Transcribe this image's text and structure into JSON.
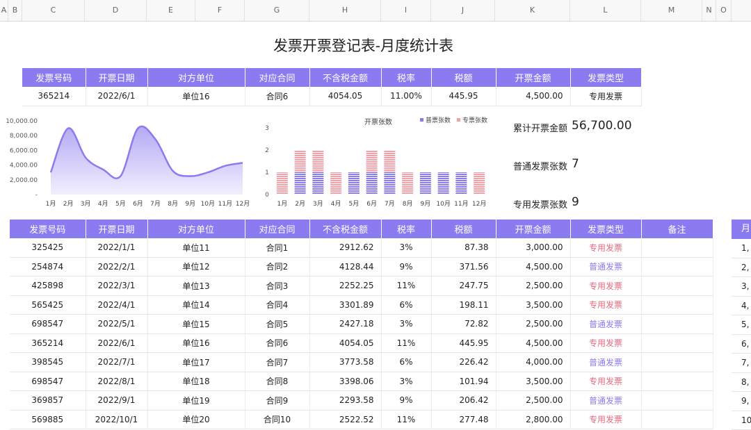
{
  "columns": [
    "A",
    "B",
    "C",
    "D",
    "E",
    "F",
    "G",
    "H",
    "I",
    "J",
    "K",
    "L",
    "M",
    "N",
    "O"
  ],
  "title": "发票开票登记表-月度统计表",
  "lookup": {
    "headers": [
      "发票号码",
      "开票日期",
      "对方单位",
      "对应合同",
      "不含税金额",
      "税率",
      "税额",
      "开票金额",
      "发票类型"
    ],
    "row": [
      "365214",
      "2022/6/1",
      "单位16",
      "合同6",
      "4054.05",
      "11.00%",
      "445.95",
      "4,500.00",
      "专用发票"
    ]
  },
  "stats": {
    "total_label": "累计开票金额",
    "total_value": "56,700.00",
    "normal_label": "普通发票张数",
    "normal_value": "7",
    "special_label": "专用发票张数",
    "special_value": "9"
  },
  "chart_data": [
    {
      "type": "area",
      "x": [
        "1月",
        "2月",
        "3月",
        "4月",
        "5月",
        "6月",
        "7月",
        "8月",
        "9月",
        "10月",
        "11月",
        "12月"
      ],
      "values": [
        3000,
        9000,
        5000,
        3400,
        2500,
        9000,
        7500,
        3200,
        2500,
        3000,
        3900,
        4300
      ],
      "ylim": [
        0,
        10000
      ],
      "yticks": [
        "10,000.00",
        "8,000.00",
        "6,000.00",
        "4,000.00",
        "2,000.00",
        "-"
      ],
      "color": "#8b7bf0"
    },
    {
      "type": "bar",
      "title": "开票张数",
      "categories": [
        "1月",
        "2月",
        "3月",
        "4月",
        "5月",
        "6月",
        "7月",
        "8月",
        "9月",
        "10月",
        "11月",
        "12月"
      ],
      "series": [
        {
          "name": "普票张数",
          "values": [
            0,
            1,
            1,
            0,
            1,
            1,
            1,
            0,
            1,
            1,
            1,
            0
          ],
          "color": "#8b7bf0"
        },
        {
          "name": "专票张数",
          "values": [
            1,
            1,
            1,
            1,
            0,
            1,
            1,
            1,
            0,
            0,
            0,
            1
          ],
          "color": "#f4a0a8"
        }
      ],
      "ylim": [
        0,
        3
      ],
      "yticks": [
        "3",
        "2",
        "1",
        "0"
      ],
      "legend": "top-right"
    }
  ],
  "main": {
    "headers": [
      "发票号码",
      "开票日期",
      "对方单位",
      "对应合同",
      "不含税金额",
      "税率",
      "税额",
      "开票金额",
      "发票类型",
      "备注"
    ],
    "rows": [
      [
        "325425",
        "2022/1/1",
        "单位11",
        "合同1",
        "2912.62",
        "3%",
        "87.38",
        "3,000.00",
        "专用发票",
        ""
      ],
      [
        "254874",
        "2022/2/1",
        "单位12",
        "合同2",
        "4128.44",
        "9%",
        "371.56",
        "4,500.00",
        "普通发票",
        ""
      ],
      [
        "425898",
        "2022/3/1",
        "单位13",
        "合同3",
        "2252.25",
        "11%",
        "247.75",
        "2,500.00",
        "专用发票",
        ""
      ],
      [
        "565425",
        "2022/4/1",
        "单位14",
        "合同4",
        "3301.89",
        "6%",
        "198.11",
        "3,500.00",
        "专用发票",
        ""
      ],
      [
        "698547",
        "2022/5/1",
        "单位15",
        "合同5",
        "2427.18",
        "3%",
        "72.82",
        "2,500.00",
        "普通发票",
        ""
      ],
      [
        "365214",
        "2022/6/1",
        "单位16",
        "合同6",
        "4054.05",
        "11%",
        "445.95",
        "4,500.00",
        "专用发票",
        ""
      ],
      [
        "398545",
        "2022/7/1",
        "单位17",
        "合同7",
        "3773.58",
        "6%",
        "226.42",
        "4,000.00",
        "普通发票",
        ""
      ],
      [
        "698547",
        "2022/8/1",
        "单位18",
        "合同8",
        "3398.06",
        "3%",
        "101.94",
        "3,500.00",
        "专用发票",
        ""
      ],
      [
        "369857",
        "2022/9/1",
        "单位19",
        "合同9",
        "2293.58",
        "9%",
        "206.42",
        "2,500.00",
        "普通发票",
        ""
      ],
      [
        "569885",
        "2022/10/1",
        "单位20",
        "合同10",
        "2522.52",
        "11%",
        "277.48",
        "2,800.00",
        "专用发票",
        ""
      ]
    ]
  },
  "edge": {
    "header": "月",
    "cells": [
      "1,",
      "2,",
      "3,",
      "4,",
      "5,",
      "6,",
      "7,",
      "8,",
      "9,",
      "10"
    ]
  },
  "colors": {
    "accent": "#8b7bf0",
    "special": "#e86a7e",
    "pink": "#f4a0a8"
  }
}
